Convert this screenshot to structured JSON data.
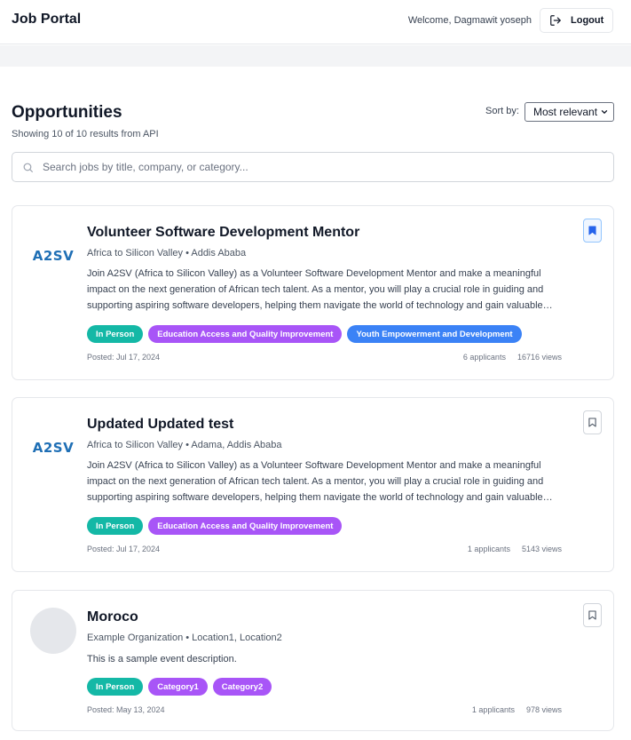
{
  "header": {
    "brand": "Job Portal",
    "welcome": "Welcome, Dagmawit yoseph",
    "logout_label": "Logout"
  },
  "main": {
    "title": "Opportunities",
    "results_text": "Showing 10 of 10 results from API",
    "sort_label": "Sort by:",
    "sort_value": "Most relevant",
    "search_placeholder": "Search jobs by title, company, or category..."
  },
  "jobs": [
    {
      "title": "Volunteer Software Development Mentor",
      "org_line": "Africa to Silicon Valley • Addis Ababa",
      "description": "Join A2SV (Africa to Silicon Valley) as a Volunteer Software Development Mentor and make a meaningful impact on the next generation of African tech talent. As a mentor, you will play a crucial role in guiding and supporting aspiring software developers, helping them navigate the world of technology and gain valuable…",
      "logo_text": "A2SV",
      "tags": [
        {
          "label": "In Person",
          "color": "#14b8a6"
        },
        {
          "label": "Education Access and Quality Improvement",
          "color": "#a855f7"
        },
        {
          "label": "Youth Empowerment and Development",
          "color": "#3b82f6"
        }
      ],
      "posted": "Posted: Jul 17, 2024",
      "applicants": "6 applicants",
      "views": "16716 views",
      "bookmarked": true
    },
    {
      "title": "Updated Updated test",
      "org_line": "Africa to Silicon Valley • Adama, Addis Ababa",
      "description": "Join A2SV (Africa to Silicon Valley) as a Volunteer Software Development Mentor and make a meaningful impact on the next generation of African tech talent. As a mentor, you will play a crucial role in guiding and supporting aspiring software developers, helping them navigate the world of technology and gain valuable…",
      "logo_text": "A2SV",
      "tags": [
        {
          "label": "In Person",
          "color": "#14b8a6"
        },
        {
          "label": "Education Access and Quality Improvement",
          "color": "#a855f7"
        }
      ],
      "posted": "Posted: Jul 17, 2024",
      "applicants": "1 applicants",
      "views": "5143 views",
      "bookmarked": false
    },
    {
      "title": "Moroco",
      "org_line": "Example Organization • Location1, Location2",
      "description": "This is a sample event description.",
      "tags": [
        {
          "label": "In Person",
          "color": "#14b8a6"
        },
        {
          "label": "Category1",
          "color": "#a855f7"
        },
        {
          "label": "Category2",
          "color": "#a855f7"
        }
      ],
      "posted": "Posted: May 13, 2024",
      "applicants": "1 applicants",
      "views": "978 views",
      "bookmarked": false
    }
  ]
}
